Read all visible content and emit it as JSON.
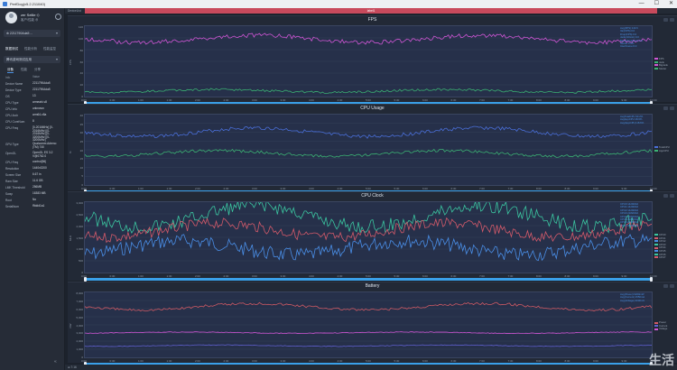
{
  "window": {
    "title": "PerfDog(v5.2.211040)",
    "controls": [
      "—",
      "☐",
      "✕"
    ]
  },
  "profile": {
    "user_name": "zer Sellie ◇",
    "sub_text": "客户/性能 ⊕",
    "gear_icon": "gear-icon"
  },
  "device": {
    "selected": "⊕ 2211790Ada5 ...",
    "options": []
  },
  "sidebar_tabs": [
    "数据测试",
    "性能分析",
    "性能监控"
  ],
  "app": {
    "selected": "腾讯游戏测试应用"
  },
  "info_tabs": [
    "设备",
    "性能",
    "分享"
  ],
  "device_info": {
    "header": {
      "key": "Info",
      "value": "Value"
    },
    "rows": [
      {
        "key": "Device Name",
        "value": "2211790Ada5"
      },
      {
        "key": "Device Type",
        "value": "2211790Ada5"
      },
      {
        "key": "OS",
        "value": "13"
      },
      {
        "key": "CPU Type",
        "value": "armeabi-v8"
      },
      {
        "key": "CPU Info",
        "value": "unknown"
      },
      {
        "key": "CPU Arch",
        "value": "arm64-v8a"
      },
      {
        "key": "CPU CoreNum",
        "value": "8"
      },
      {
        "key": "CPU Freq",
        "value": "[0-2016MHz] [0-2016MHz] [0-2016MHz] [0-3200MHz] [0-3200MHz]"
      },
      {
        "key": "GPU Type",
        "value": "Qualcomm Adreno (TM) 740"
      },
      {
        "key": "OpenGL",
        "value": "OpenGL ES 3.2 V@0762.0"
      },
      {
        "key": "CPU Freq",
        "value": "control(56)"
      },
      {
        "key": "Resolution",
        "value": "1440x3200"
      },
      {
        "key": "Screen Size",
        "value": "6.67 in"
      },
      {
        "key": "Ram Size",
        "value": "11.6 GB"
      },
      {
        "key": "LMK Threshold",
        "value": "256MB"
      },
      {
        "key": "Swap",
        "value": "16383 MB"
      },
      {
        "key": "Root",
        "value": "No"
      },
      {
        "key": "SerialNum",
        "value": "f9ddd1a1"
      }
    ]
  },
  "main": {
    "topbar_label": "DeviceList",
    "record_label": "label1",
    "status_text": "⊞ 7:16",
    "watermark": "生活",
    "watermark_url": "www.3elife.net"
  },
  "colors": {
    "fps_line": "#d156d6",
    "jank_line": "#3bb273",
    "cpu_total": "#4a6fd9",
    "cpu_app": "#3bb273",
    "clock_a": "#3bc6a0",
    "clock_b": "#d45a6a",
    "clock_c": "#4a8fe8",
    "battery_line": "#d05a64",
    "battery_b": "#6060d0",
    "slider": "#3aa0e8",
    "record_bar": "#c84a5c"
  },
  "charts": {
    "fps": {
      "title": "FPS",
      "ylabel": "FPS",
      "yticks": [
        "120",
        "100",
        "80",
        "60",
        "40",
        "20",
        "0"
      ],
      "xticks": [
        "0:00",
        "0:30",
        "1:00",
        "1:30",
        "2:00",
        "2:30",
        "3:00",
        "3:30",
        "4:00",
        "4:30",
        "5:00",
        "5:30",
        "6:00",
        "6:30",
        "7:00",
        "7:30",
        "8:00",
        "8:30",
        "9:00",
        "9:30",
        "10:00"
      ],
      "legend_box": [
        "Avg(FPS):119.6",
        "Var(FPS):0.0",
        "Drop(FPS):0.0",
        "Jank(/10min):0.0",
        "BigJank(/10min):0.0",
        "Stutter:0.0%",
        "InterFrame:0.0"
      ],
      "legend_side": [
        "FPS",
        "Jank",
        "BigJank",
        "Stutter"
      ]
    },
    "cpu": {
      "title": "CPU Usage",
      "ylabel": "%",
      "yticks": [
        "40",
        "35",
        "30",
        "25",
        "20",
        "15",
        "10",
        "5",
        "0"
      ],
      "xticks": [
        "0:00",
        "0:30",
        "1:00",
        "1:30",
        "2:00",
        "2:30",
        "3:00",
        "3:30",
        "4:00",
        "4:30",
        "5:00",
        "5:30",
        "6:00",
        "6:30",
        "7:00",
        "7:30",
        "8:00",
        "8:30",
        "9:00",
        "9:30",
        "10:00"
      ],
      "legend_box": [
        "AvgTotalCPU:33.2%",
        "AvgAppCPU:18.6%",
        "Avg(AppCPU):18.6%"
      ],
      "legend_side": [
        "TotalCPU",
        "AppCPU"
      ]
    },
    "clock": {
      "title": "CPU Clock",
      "ylabel": "MHz",
      "yticks": [
        "3,000",
        "2,500",
        "2,000",
        "1,500",
        "1,000",
        "500",
        "0"
      ],
      "xticks": [
        "0:00",
        "0:30",
        "1:00",
        "1:30",
        "2:00",
        "2:30",
        "3:00",
        "3:30",
        "4:00",
        "4:30",
        "5:00",
        "5:30",
        "6:00",
        "6:30",
        "7:00",
        "7:30",
        "8:00",
        "8:30",
        "9:00",
        "9:30",
        "10:00"
      ],
      "legend_box": [
        "CPU0:1420MHz",
        "CPU1:1420MHz",
        "CPU2:1420MHz",
        "CPU3:2182MHz",
        "CPU4:2182MHz",
        "CPU5:2182MHz",
        "CPU6:2188MHz",
        "CPU7:2890MHz"
      ],
      "legend_side": [
        "CPU0",
        "CPU1",
        "CPU2",
        "CPU3",
        "CPU4",
        "CPU5",
        "CPU6",
        "CPU7"
      ]
    },
    "battery": {
      "title": "Battery",
      "ylabel": "mW",
      "yticks": [
        "8,000",
        "7,000",
        "6,000",
        "5,000",
        "4,000",
        "3,000",
        "2,000",
        "1,000",
        "0"
      ],
      "xticks": [
        "0:00",
        "0:30",
        "1:00",
        "1:30",
        "2:00",
        "2:30",
        "3:00",
        "3:30",
        "4:00",
        "4:30",
        "5:00",
        "5:30",
        "6:00",
        "6:30",
        "7:00",
        "7:30",
        "8:00",
        "8:30",
        "9:00",
        "9:30",
        "10:00"
      ],
      "legend_box": [
        "Avg(Power):6200mW",
        "Avg(Current):1550mA",
        "Avg(Voltage):4000mV"
      ],
      "legend_side": [
        "Power",
        "Current",
        "Voltage"
      ]
    }
  }
}
